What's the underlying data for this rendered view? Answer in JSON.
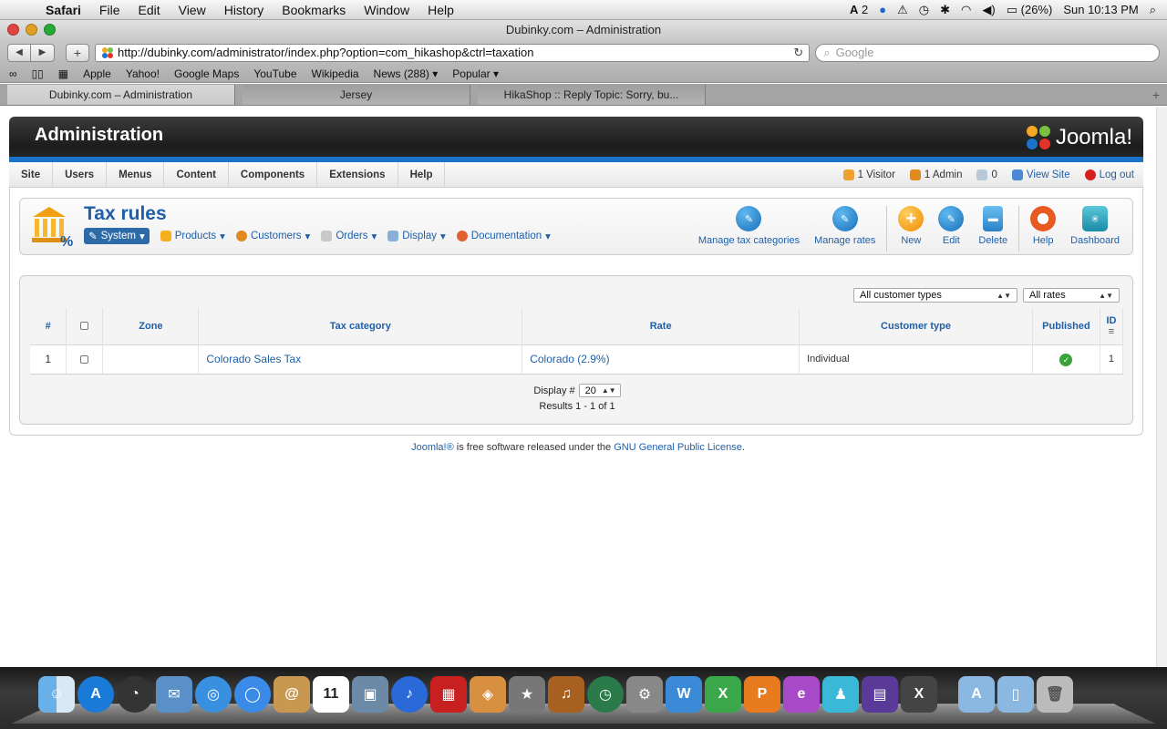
{
  "menubar": {
    "app": "Safari",
    "items": [
      "File",
      "Edit",
      "View",
      "History",
      "Bookmarks",
      "Window",
      "Help"
    ],
    "status": {
      "adobe": "2",
      "battery": "(26%)",
      "clock": "Sun 10:13 PM"
    }
  },
  "window": {
    "title": "Dubinky.com – Administration",
    "url": "http://dubinky.com/administrator/index.php?option=com_hikashop&ctrl=taxation",
    "search_placeholder": "Google"
  },
  "bookmarks": [
    "Apple",
    "Yahoo!",
    "Google Maps",
    "YouTube",
    "Wikipedia",
    "News (288) ▾",
    "Popular ▾"
  ],
  "tabs": [
    {
      "label": "Dubinky.com – Administration",
      "active": true
    },
    {
      "label": "Jersey",
      "active": false
    },
    {
      "label": "HikaShop :: Reply Topic: Sorry, bu...",
      "active": false
    }
  ],
  "joomla": {
    "header_title": "Administration",
    "logo_text": "Joomla!",
    "menu": [
      "Site",
      "Users",
      "Menus",
      "Content",
      "Components",
      "Extensions",
      "Help"
    ],
    "status": {
      "visitors": "1 Visitor",
      "admins": "1 Admin",
      "messages": "0",
      "view_site": "View Site",
      "logout": "Log out"
    }
  },
  "toolbox": {
    "title": "Tax rules",
    "submenu": [
      "System",
      "Products",
      "Customers",
      "Orders",
      "Display",
      "Documentation"
    ],
    "buttons": {
      "manage_tax_categories": "Manage tax categories",
      "manage_rates": "Manage rates",
      "new": "New",
      "edit": "Edit",
      "delete": "Delete",
      "help": "Help",
      "dashboard": "Dashboard"
    }
  },
  "filters": {
    "customer_types": "All customer types",
    "rates": "All rates"
  },
  "table": {
    "headers": [
      "#",
      "",
      "Zone",
      "Tax category",
      "Rate",
      "Customer type",
      "Published",
      "ID"
    ],
    "rows": [
      {
        "num": "1",
        "zone": "",
        "tax_category": "Colorado Sales Tax",
        "rate": "Colorado (2.9%)",
        "customer_type": "Individual",
        "id": "1"
      }
    ]
  },
  "pager": {
    "display_label": "Display #",
    "display_value": "20",
    "results": "Results 1 - 1 of 1"
  },
  "footer": {
    "joomla_link": "Joomla!®",
    "text": " is free software released under the ",
    "license_link": "GNU General Public License",
    "period": "."
  },
  "colors": {
    "accent": "#1f5fa8",
    "header_dark": "#222222",
    "strip": "#1a73c8"
  }
}
